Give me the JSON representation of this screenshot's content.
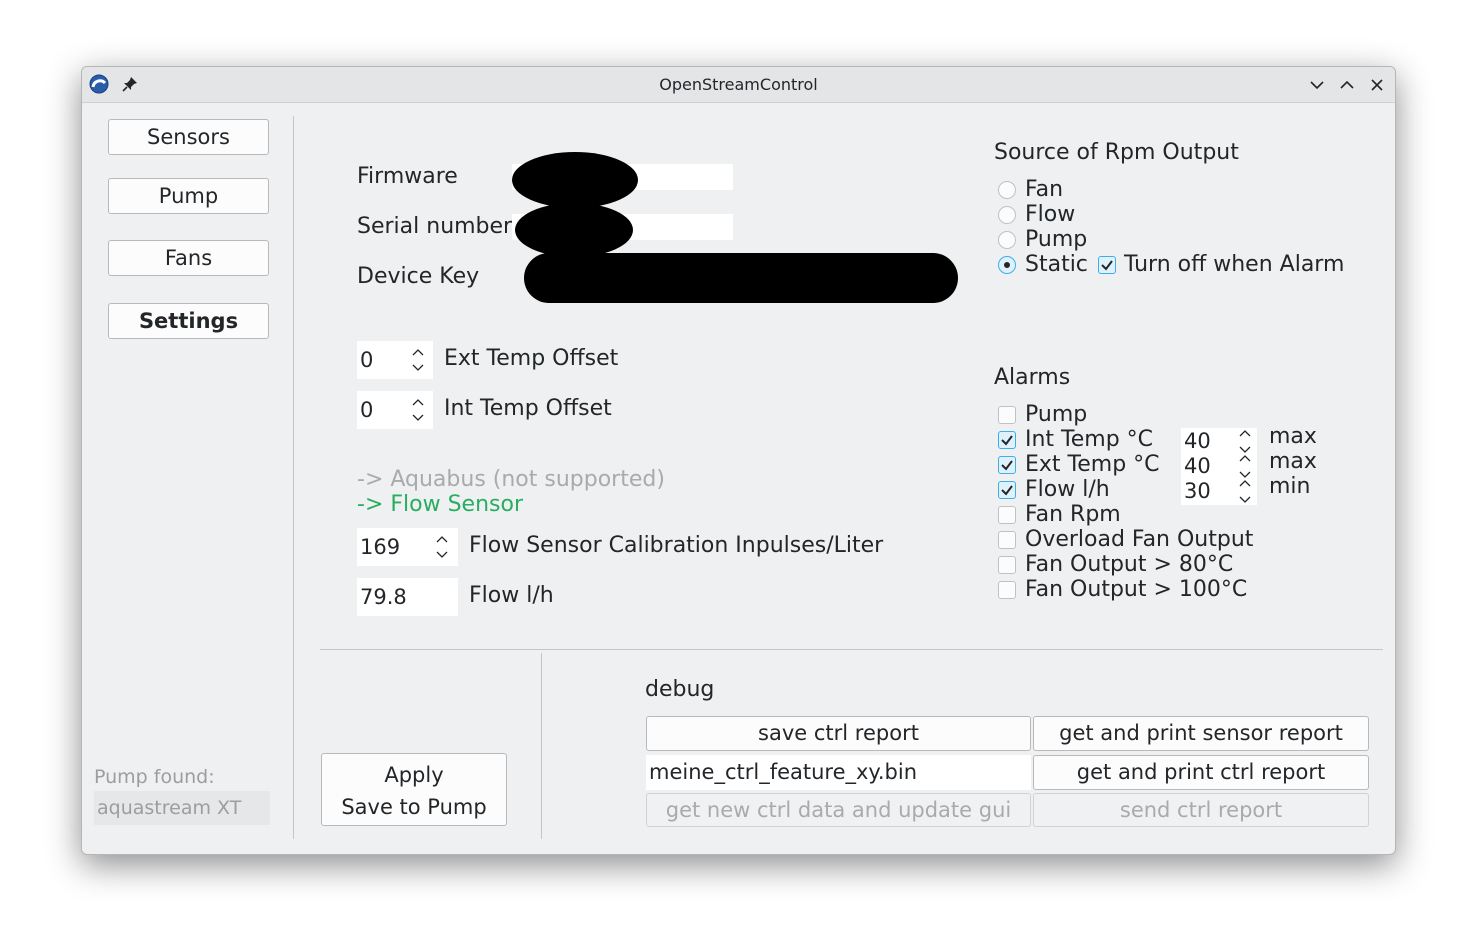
{
  "window": {
    "title": "OpenStreamControl"
  },
  "sidebar": {
    "items": [
      {
        "label": "Sensors"
      },
      {
        "label": "Pump"
      },
      {
        "label": "Fans"
      },
      {
        "label": "Settings"
      }
    ],
    "pump_found_label": "Pump found:",
    "pump_found_value": "aquastream XT"
  },
  "device_info": {
    "firmware_label": "Firmware",
    "serial_label": "Serial number",
    "device_key_label": "Device Key"
  },
  "offsets": {
    "ext_temp": {
      "value": "0",
      "label": "Ext Temp Offset"
    },
    "int_temp": {
      "value": "0",
      "label": "Int Temp Offset"
    }
  },
  "links": {
    "aquabus": "-> Aquabus (not supported)",
    "flow_sensor": "-> Flow Sensor"
  },
  "flow": {
    "calibration_value": "169",
    "calibration_label": "Flow Sensor Calibration Inpulses/Liter",
    "flow_value": "79.8",
    "flow_label": "Flow l/h"
  },
  "rpm_output": {
    "title": "Source of Rpm Output",
    "options": [
      {
        "label": "Fan",
        "selected": false
      },
      {
        "label": "Flow",
        "selected": false
      },
      {
        "label": "Pump",
        "selected": false
      },
      {
        "label": "Static",
        "selected": true
      }
    ],
    "turn_off_label": "Turn off when Alarm",
    "turn_off_checked": true
  },
  "alarms": {
    "title": "Alarms",
    "items": [
      {
        "label": "Pump",
        "checked": false
      },
      {
        "label": "Int Temp °C",
        "checked": true,
        "value": "40",
        "unit": "max"
      },
      {
        "label": "Ext Temp °C",
        "checked": true,
        "value": "40",
        "unit": "max"
      },
      {
        "label": "Flow l/h",
        "checked": true,
        "value": "30",
        "unit": "min"
      },
      {
        "label": "Fan Rpm",
        "checked": false
      },
      {
        "label": "Overload Fan Output",
        "checked": false
      },
      {
        "label": "Fan Output > 80°C",
        "checked": false
      },
      {
        "label": "Fan Output > 100°C",
        "checked": false
      }
    ]
  },
  "actions": {
    "apply_label": "Apply",
    "save_label": "Save to Pump"
  },
  "debug": {
    "title": "debug",
    "save_ctrl_report": "save ctrl report",
    "get_print_sensor_report": "get and print sensor report",
    "filename": "meine_ctrl_feature_xy.bin",
    "get_print_ctrl_report": "get and print ctrl report",
    "get_new_ctrl_data": "get new ctrl data and update gui",
    "send_ctrl_report": "send ctrl report"
  },
  "colors": {
    "accent": "#3daee9",
    "flow_sensor_link": "#27ae60",
    "disabled_text": "#a8aaac"
  }
}
